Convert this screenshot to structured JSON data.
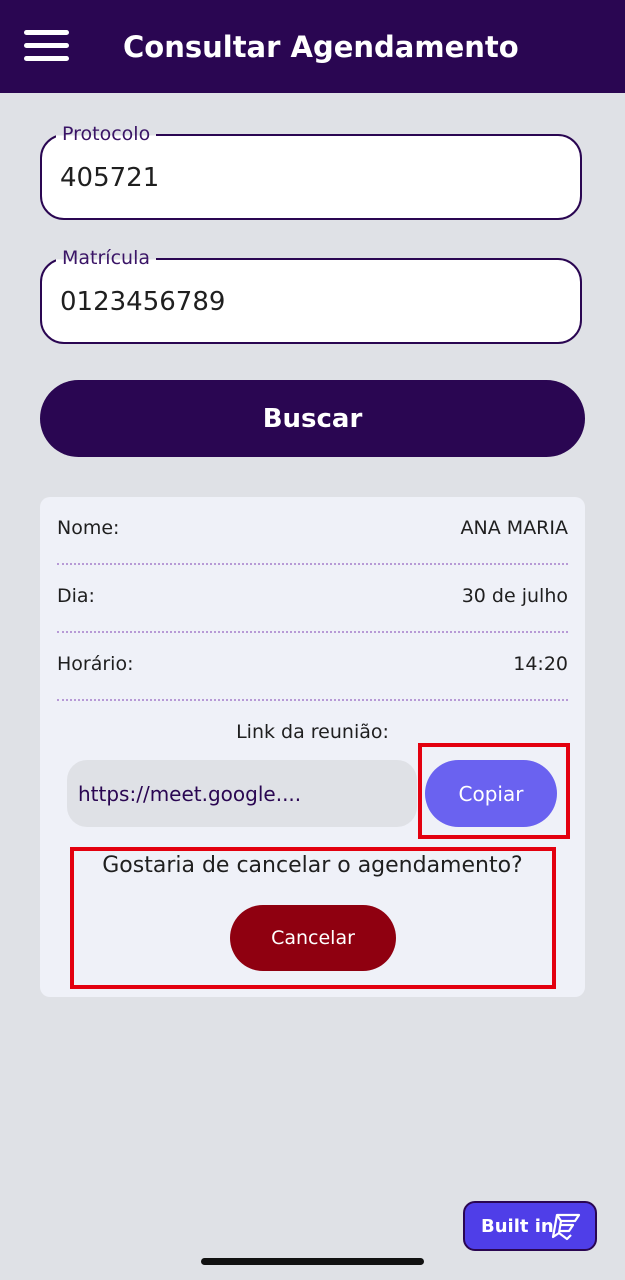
{
  "appbar": {
    "title": "Consultar Agendamento"
  },
  "form": {
    "protocolo": {
      "label": "Protocolo",
      "value": "405721"
    },
    "matricula": {
      "label": "Matrícula",
      "value": "0123456789"
    },
    "search_label": "Buscar"
  },
  "result": {
    "rows": [
      {
        "label": "Nome:",
        "value": "ANA MARIA"
      },
      {
        "label": "Dia:",
        "value": "30 de julho"
      },
      {
        "label": "Horário:",
        "value": "14:20"
      }
    ],
    "link_title": "Link da reunião:",
    "link_value": "https://meet.google....",
    "copy_label": "Copiar",
    "cancel_question": "Gostaria de cancelar o agendamento?",
    "cancel_label": "Cancelar"
  },
  "badge": {
    "label": "Built in"
  },
  "colors": {
    "primary": "#2a0652",
    "background": "#dfe1e6",
    "card": "#eff1f8",
    "copy_button": "#6a62f0",
    "cancel_button": "#8f0010",
    "highlight": "#e3000f",
    "badge": "#4f3ee8"
  },
  "icons": {
    "menu": "hamburger-menu-icon",
    "badge": "flutterflow-logo-icon"
  }
}
